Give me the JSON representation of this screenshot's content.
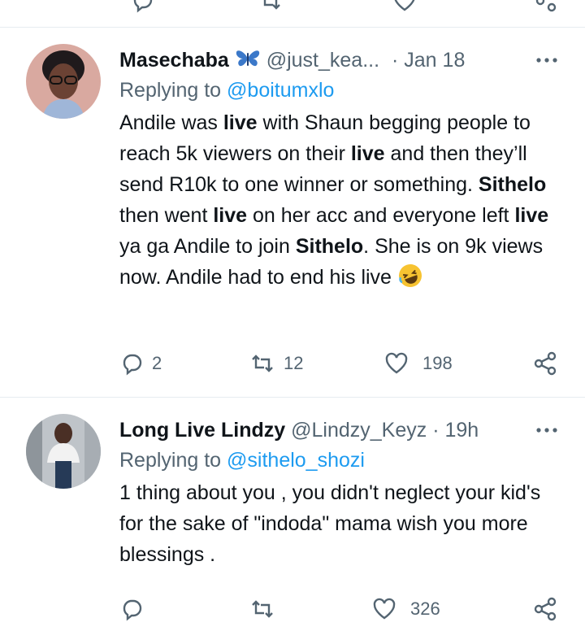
{
  "tweets": [
    {
      "name": "Masechaba",
      "handle": "@just_kea...",
      "separator": "·",
      "time": "Jan 18",
      "replying_prefix": "Replying to",
      "replying_to": "@boitumxlo",
      "body": [
        {
          "t": "Andile was ",
          "b": false
        },
        {
          "t": "live",
          "b": true
        },
        {
          "t": " with Shaun begging people to reach 5k viewers on their ",
          "b": false
        },
        {
          "t": "live",
          "b": true
        },
        {
          "t": " and then they’ll send R10k to one winner or something. ",
          "b": false
        },
        {
          "t": "Sithelo",
          "b": true
        },
        {
          "t": " then went ",
          "b": false
        },
        {
          "t": "live",
          "b": true
        },
        {
          "t": " on her acc and everyone left ",
          "b": false
        },
        {
          "t": "live",
          "b": true
        },
        {
          "t": " ya ga Andile to join ",
          "b": false
        },
        {
          "t": "Sithelo",
          "b": true
        },
        {
          "t": ". She is on 9k views now. Andile had to end his live ",
          "b": false
        }
      ],
      "counts": {
        "replies": "2",
        "retweets": "12",
        "likes": "198"
      }
    },
    {
      "name": "Long Live Lindzy",
      "handle": "@Lindzy_Keyz",
      "separator": "·",
      "time": "19h",
      "replying_prefix": "Replying to",
      "replying_to": "@sithelo_shozi",
      "body_text": "1 thing about you , you didn't neglect your kid's for the sake of \"indoda\" mama wish you more blessings .",
      "counts": {
        "likes": "326"
      }
    }
  ],
  "colors": {
    "accent": "#1d9bf0",
    "secondary": "#536471",
    "divider": "#e6ecf0"
  },
  "icons": [
    "reply-icon",
    "retweet-icon",
    "like-icon",
    "share-icon",
    "more-icon",
    "butterfly-icon",
    "laughing-emoji"
  ]
}
